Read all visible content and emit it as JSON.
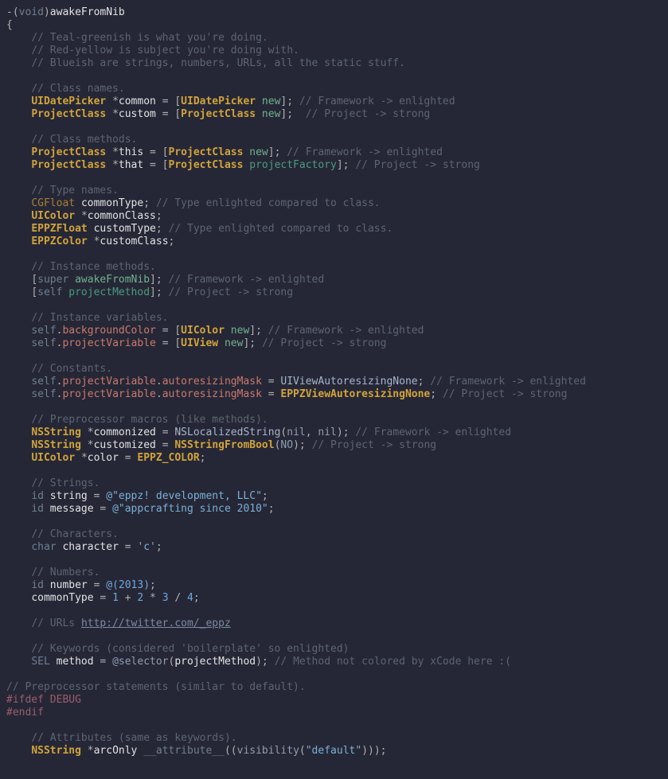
{
  "method_signature": {
    "ret": "void",
    "name": "awakeFromNib"
  },
  "comments": {
    "intro1": "// Teal-greenish is what you're doing.",
    "intro2": "// Red-yellow is subject you're doing with.",
    "intro3": "// Blueish are strings, numbers, URLs, all the static stuff.",
    "class_names": "// Class names.",
    "class_methods": "// Class methods.",
    "type_names": "// Type names.",
    "instance_methods": "// Instance methods.",
    "instance_variables": "// Instance variables.",
    "constants": "// Constants.",
    "preproc_macros": "// Preprocessor macros (like methods).",
    "strings": "// Strings.",
    "characters": "// Characters.",
    "numbers": "// Numbers.",
    "urls": "// URLs ",
    "keywords": "// Keywords (considered 'boilerplate' so enlighted)",
    "preproc_statements": "// Preprocessor statements (similar to default).",
    "attributes": "// Attributes (same as keywords).",
    "framework_enlighted": "// Framework -> enlighted",
    "project_strong": "// Project -> strong",
    "type_enlighted": "// Type enlighted compared to class.",
    "method_not_colored": "// Method not colored by xCode here :("
  },
  "classes": {
    "UIDatePicker": "UIDatePicker",
    "ProjectClass": "ProjectClass",
    "CGFloat": "CGFloat",
    "UIColor": "UIColor",
    "EPPZFloat": "EPPZFloat",
    "EPPZColor": "EPPZColor",
    "NSString": "NSString",
    "UIView": "UIView"
  },
  "vars": {
    "common": "common",
    "custom": "custom",
    "this": "this",
    "that": "that",
    "commonType": "commonType",
    "commonClass": "commonClass",
    "customType": "customType",
    "customClass": "customClass",
    "commonized": "commonized",
    "customized": "customized",
    "color": "color",
    "string": "string",
    "message": "message",
    "character": "character",
    "number": "number",
    "method": "method",
    "arcOnly": "arcOnly"
  },
  "methods": {
    "new": "new",
    "projectFactory": "projectFactory",
    "awakeFromNib": "awakeFromNib",
    "projectMethod": "projectMethod"
  },
  "properties": {
    "backgroundColor": "backgroundColor",
    "projectVariable": "projectVariable",
    "autoresizingMask": "autoresizingMask"
  },
  "constants": {
    "UIViewAutoresizingNone": "UIViewAutoresizingNone",
    "EPPZViewAutoresizingNone": "EPPZViewAutoresizingNone",
    "NSLocalizedString": "NSLocalizedString",
    "NSStringFromBool": "NSStringFromBool",
    "EPPZ_COLOR": "EPPZ_COLOR"
  },
  "literals": {
    "nil": "nil",
    "NO": "NO",
    "string1": "@\"eppz! development, LLC\"",
    "string2": "@\"appcrafting since 2010\"",
    "char": "'c'",
    "num_year": "2013",
    "n1": "1",
    "n2": "2",
    "n3": "3",
    "n4": "4",
    "default": "\"default\""
  },
  "keywords": {
    "void": "void",
    "super": "super",
    "self": "self",
    "id": "id",
    "char": "char",
    "SEL": "SEL",
    "selector": "selector",
    "attribute": "__attribute__",
    "visibility": "visibility",
    "ifdef": "#ifdef",
    "endif": "#endif",
    "DEBUG": "DEBUG"
  },
  "url": {
    "text": "http://twitter.com/_eppz",
    "href": "http://twitter.com/_eppz"
  }
}
